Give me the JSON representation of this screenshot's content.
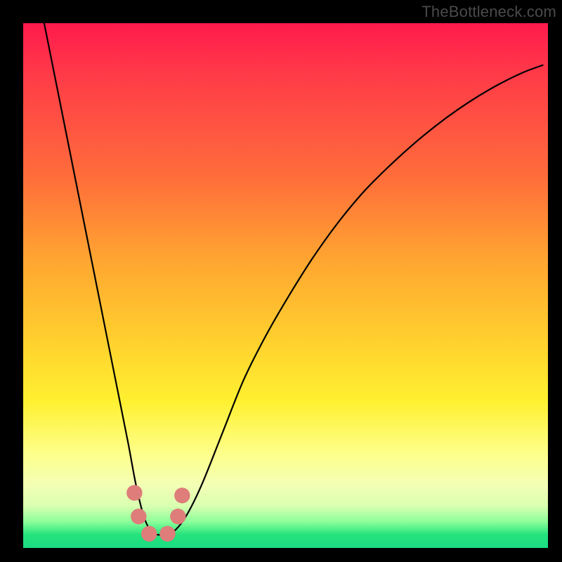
{
  "watermark": "TheBottleneck.com",
  "colors": {
    "background": "#000000",
    "curve": "#000000",
    "marker": "#de7d7a",
    "gradient_stops": [
      "#ff1a4d",
      "#ff3b48",
      "#ff6f3a",
      "#ffa531",
      "#ffcf2e",
      "#fff030",
      "#fdff8a",
      "#f3ffb5",
      "#d9ffb0",
      "#8cff9a",
      "#24e37c",
      "#1bdc82"
    ]
  },
  "chart_data": {
    "type": "line",
    "title": "",
    "xlabel": "",
    "ylabel": "",
    "xlim": [
      0,
      100
    ],
    "ylim": [
      0,
      100
    ],
    "grid": false,
    "series": [
      {
        "name": "bottleneck-curve",
        "x": [
          4,
          6,
          8,
          10,
          12,
          14,
          16,
          18,
          20,
          21.5,
          23,
          24.5,
          26.5,
          28.5,
          31,
          34,
          38,
          42,
          46,
          50,
          55,
          60,
          65,
          70,
          75,
          80,
          85,
          90,
          95,
          99
        ],
        "values": [
          100,
          90,
          80,
          70,
          60,
          50,
          40,
          30,
          20,
          12,
          6,
          3,
          2.5,
          3,
          6,
          12,
          22,
          32,
          40,
          47,
          55,
          62,
          68,
          73,
          77.5,
          81.5,
          85,
          88,
          90.5,
          92
        ]
      }
    ],
    "markers": [
      {
        "name": "left-shoulder-top",
        "x": 21.2,
        "value": 10.5
      },
      {
        "name": "left-shoulder-bot",
        "x": 22.0,
        "value": 6.0
      },
      {
        "name": "trough-left",
        "x": 24.0,
        "value": 2.7
      },
      {
        "name": "trough-right",
        "x": 27.5,
        "value": 2.7
      },
      {
        "name": "right-shoulder-bot",
        "x": 29.5,
        "value": 6.0
      },
      {
        "name": "right-shoulder-top",
        "x": 30.3,
        "value": 10.0
      }
    ],
    "marker_radius_pct": 1.5
  }
}
